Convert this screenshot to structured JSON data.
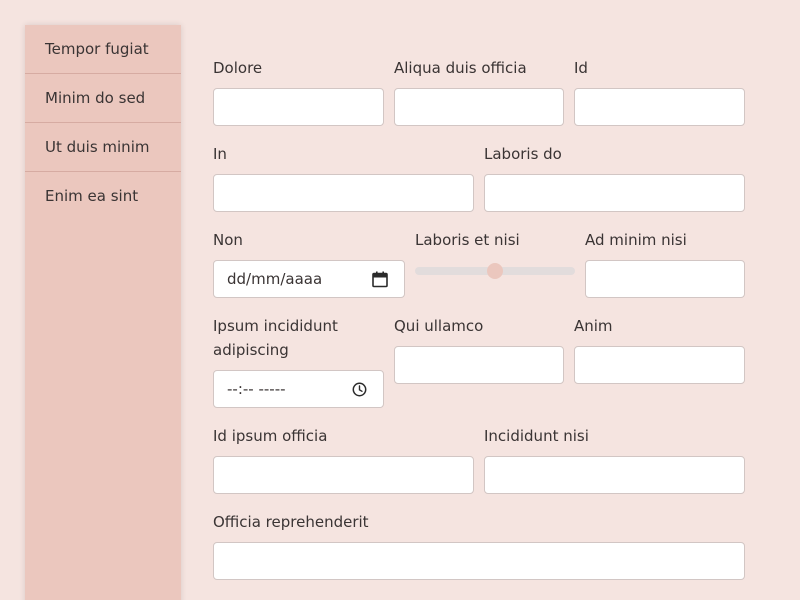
{
  "sidebar": {
    "items": [
      {
        "label": "Tempor fugiat"
      },
      {
        "label": "Minim do sed"
      },
      {
        "label": "Ut duis minim"
      },
      {
        "label": "Enim ea sint"
      }
    ]
  },
  "form": {
    "dolore": {
      "label": "Dolore",
      "value": ""
    },
    "aliqua": {
      "label": "Aliqua duis officia",
      "value": ""
    },
    "id": {
      "label": "Id",
      "value": ""
    },
    "in": {
      "label": "In",
      "value": ""
    },
    "laboris_do": {
      "label": "Laboris do",
      "value": ""
    },
    "non": {
      "label": "Non",
      "placeholder": "dd/mm/aaaa"
    },
    "laboris_nisi": {
      "label": "Laboris et nisi",
      "value_fraction": 0.5
    },
    "ad_minim": {
      "label": "Ad minim nisi",
      "value": ""
    },
    "ipsum": {
      "label_line1": "Ipsum incididunt",
      "label_line2": "adipiscing",
      "placeholder": "--:-- -----"
    },
    "qui": {
      "label": "Qui ullamco",
      "value": ""
    },
    "anim": {
      "label": "Anim",
      "value": ""
    },
    "id_ipsum": {
      "label": "Id ipsum officia",
      "value": ""
    },
    "incididunt": {
      "label": "Incididunt nisi",
      "value": ""
    },
    "officia": {
      "label": "Officia reprehenderit",
      "value": ""
    }
  },
  "colors": {
    "background": "#f5e4e0",
    "sidebar": "#ebc7be",
    "accent": "#ebc7be"
  },
  "icons": {
    "date": "calendar-icon",
    "time": "clock-icon"
  }
}
